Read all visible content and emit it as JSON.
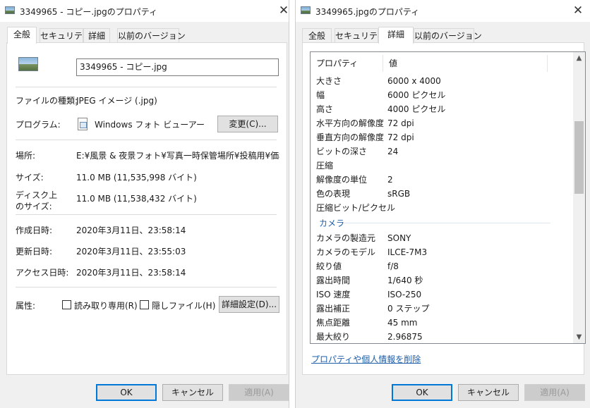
{
  "left_window": {
    "title": "3349965 - コピー.jpgのプロパティ",
    "close_glyph": "✕",
    "tabs": [
      "全般",
      "セキュリティ",
      "詳細",
      "以前のバージョン"
    ],
    "active_tab": "全般",
    "filename": "3349965 - コピー.jpg",
    "file_type_label": "ファイルの種類:",
    "file_type_value": "JPEG イメージ (.jpg)",
    "program_label": "プログラム:",
    "program_value": "Windows フォト ビューアー",
    "change_button": "変更(C)...",
    "location_label": "場所:",
    "location_value": "E:¥風景 & 夜景フォト¥写真一時保管場所¥投稿用¥価格 C",
    "size_label": "サイズ:",
    "size_value": "11.0 MB (11,535,998 バイト)",
    "disk_size_label_1": "ディスク上",
    "disk_size_label_2": "のサイズ:",
    "disk_size_value": "11.0 MB (11,538,432 バイト)",
    "created_label": "作成日時:",
    "created_value": "2020年3月11日、23:58:14",
    "modified_label": "更新日時:",
    "modified_value": "2020年3月11日、23:55:03",
    "accessed_label": "アクセス日時:",
    "accessed_value": "2020年3月11日、23:58:14",
    "attributes_label": "属性:",
    "readonly_label": "読み取り専用(R)",
    "hidden_label": "隠しファイル(H)",
    "advanced_button": "詳細設定(D)...",
    "ok_button": "OK",
    "cancel_button": "キャンセル",
    "apply_button": "適用(A)"
  },
  "right_window": {
    "title": "3349965.jpgのプロパティ",
    "close_glyph": "✕",
    "tabs": [
      "全般",
      "セキュリティ",
      "詳細",
      "以前のバージョン"
    ],
    "active_tab": "詳細",
    "col_property": "プロパティ",
    "col_value": "値",
    "rows": [
      {
        "k": "大きさ",
        "v": "6000 x 4000"
      },
      {
        "k": "幅",
        "v": "6000 ピクセル"
      },
      {
        "k": "高さ",
        "v": "4000 ピクセル"
      },
      {
        "k": "水平方向の解像度",
        "v": "72 dpi"
      },
      {
        "k": "垂直方向の解像度",
        "v": "72 dpi"
      },
      {
        "k": "ビットの深さ",
        "v": "24"
      },
      {
        "k": "圧縮",
        "v": ""
      },
      {
        "k": "解像度の単位",
        "v": "2"
      },
      {
        "k": "色の表現",
        "v": "sRGB"
      },
      {
        "k": "圧縮ビット/ピクセル",
        "v": ""
      }
    ],
    "group_camera": "カメラ",
    "camera_rows": [
      {
        "k": "カメラの製造元",
        "v": "SONY"
      },
      {
        "k": "カメラのモデル",
        "v": "ILCE-7M3"
      },
      {
        "k": "絞り値",
        "v": "f/8"
      },
      {
        "k": "露出時間",
        "v": "1/640 秒"
      },
      {
        "k": "ISO 速度",
        "v": "ISO-250"
      },
      {
        "k": "露出補正",
        "v": "0 ステップ"
      },
      {
        "k": "焦点距離",
        "v": "45 mm"
      },
      {
        "k": "最大絞り",
        "v": "2.96875"
      }
    ],
    "remove_link": "プロパティや個人情報を削除",
    "ok_button": "OK",
    "cancel_button": "キャンセル",
    "apply_button": "適用(A)"
  }
}
